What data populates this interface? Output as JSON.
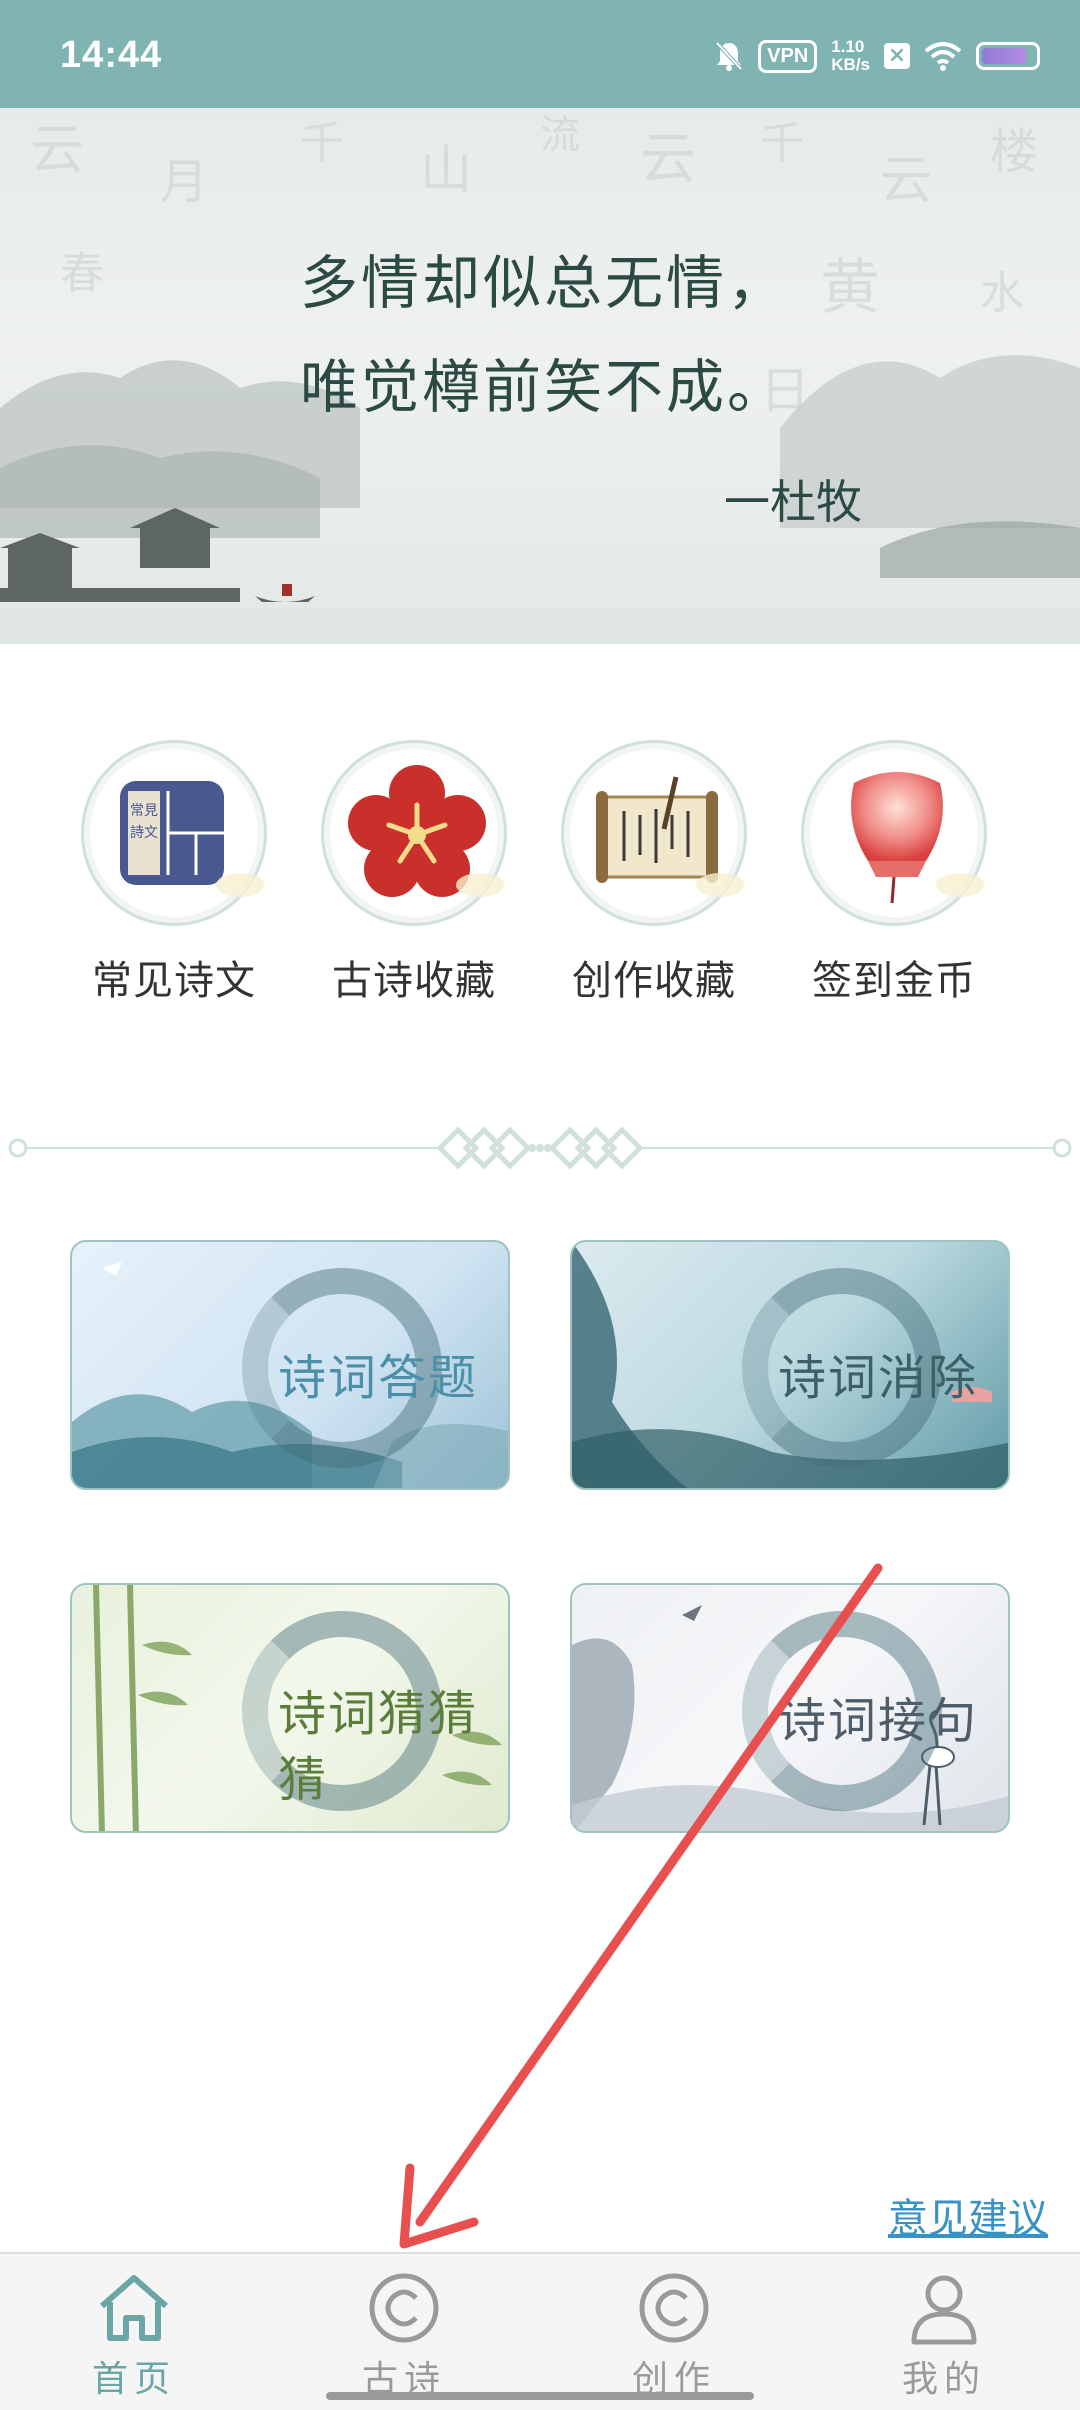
{
  "status_bar": {
    "time": "14:44",
    "vpn": "VPN",
    "speed_value": "1.10",
    "speed_unit": "KB/s",
    "battery_icon": "battery-icon"
  },
  "banner": {
    "line1": "多情却似总无情，",
    "line2": "唯觉樽前笑不成。",
    "author": "一杜牧"
  },
  "quick_items": [
    {
      "label": "常见诗文",
      "icon": "book-icon"
    },
    {
      "label": "古诗收藏",
      "icon": "plum-blossom-icon"
    },
    {
      "label": "创作收藏",
      "icon": "scroll-icon"
    },
    {
      "label": "签到金币",
      "icon": "lantern-icon"
    }
  ],
  "cards": [
    {
      "title": "诗词答题",
      "color": "#4d8fa8"
    },
    {
      "title": "诗词消除",
      "color": "#3d5f66"
    },
    {
      "title": "诗词猜猜猜",
      "color": "#5b7d3a"
    },
    {
      "title": "诗词接句",
      "color": "#4f5d6a"
    }
  ],
  "feedback_link": "意见建议",
  "nav": [
    {
      "label": "首页",
      "icon": "home-icon",
      "active": true
    },
    {
      "label": "古诗",
      "icon": "copyright-circle-icon",
      "active": false
    },
    {
      "label": "创作",
      "icon": "copyright-circle-icon",
      "active": false
    },
    {
      "label": "我的",
      "icon": "user-icon",
      "active": false
    }
  ],
  "colors": {
    "accent": "#7fb4b3",
    "nav_active": "#6aa6a6",
    "link": "#3a92c4",
    "annotation_arrow": "#e8504f"
  }
}
